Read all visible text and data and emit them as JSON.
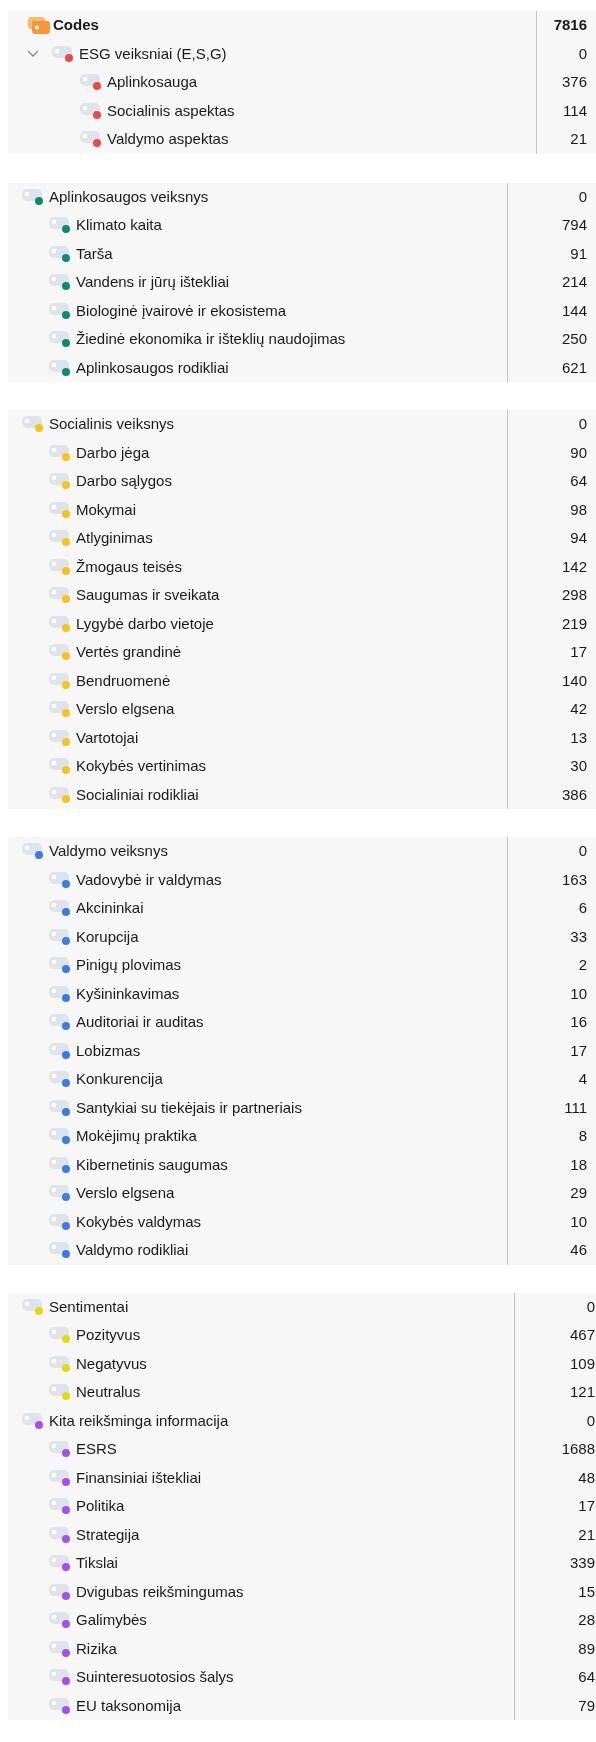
{
  "panels": [
    {
      "root": {
        "label": "Codes",
        "count": "7816"
      },
      "items": [
        {
          "label": "ESG veiksniai (E,S,G)",
          "count": "0",
          "color": "#ec4a4a",
          "expanded": true,
          "children": [
            {
              "label": "Aplinkosauga",
              "count": "376",
              "color": "#ec4a4a"
            },
            {
              "label": "Socialinis aspektas",
              "count": "114",
              "color": "#ec4a4a"
            },
            {
              "label": "Valdymo aspektas",
              "count": "21",
              "color": "#ec4a4a"
            }
          ]
        }
      ]
    },
    {
      "items": [
        {
          "label": "Aplinkosaugos veiksnys",
          "count": "0",
          "color": "#0e8a6c",
          "children": [
            {
              "label": "Klimato kaita",
              "count": "794",
              "color": "#0e8a6c"
            },
            {
              "label": "Tarša",
              "count": "91",
              "color": "#0e8a6c"
            },
            {
              "label": "Vandens ir jūrų ištekliai",
              "count": "214",
              "color": "#0e8a6c"
            },
            {
              "label": "Biologinė įvairovė ir ekosistema",
              "count": "144",
              "color": "#0e8a6c"
            },
            {
              "label": "Žiedinė ekonomika ir išteklių naudojimas",
              "count": "250",
              "color": "#0e8a6c"
            },
            {
              "label": "Aplinkosaugos rodikliai",
              "count": "621",
              "color": "#0e8a6c"
            }
          ]
        }
      ]
    },
    {
      "items": [
        {
          "label": "Socialinis veiksnys",
          "count": "0",
          "color": "#f7c31c",
          "children": [
            {
              "label": "Darbo jėga",
              "count": "90",
              "color": "#f7c31c"
            },
            {
              "label": "Darbo sąlygos",
              "count": "64",
              "color": "#f7c31c"
            },
            {
              "label": "Mokymai",
              "count": "98",
              "color": "#f7c31c"
            },
            {
              "label": "Atlyginimas",
              "count": "94",
              "color": "#f7c31c"
            },
            {
              "label": "Žmogaus teisės",
              "count": "142",
              "color": "#f7c31c"
            },
            {
              "label": "Saugumas ir sveikata",
              "count": "298",
              "color": "#f7c31c"
            },
            {
              "label": "Lygybė darbo vietoje",
              "count": "219",
              "color": "#f7c31c"
            },
            {
              "label": "Vertės grandinė",
              "count": "17",
              "color": "#f7c31c"
            },
            {
              "label": "Bendruomenė",
              "count": "140",
              "color": "#f7c31c"
            },
            {
              "label": "Verslo elgsena",
              "count": "42",
              "color": "#f7c31c"
            },
            {
              "label": "Vartotojai",
              "count": "13",
              "color": "#f7c31c"
            },
            {
              "label": "Kokybės vertinimas",
              "count": "30",
              "color": "#f7c31c"
            },
            {
              "label": "Socialiniai rodikliai",
              "count": "386",
              "color": "#f7c31c"
            }
          ]
        }
      ]
    },
    {
      "items": [
        {
          "label": "Valdymo veiksnys",
          "count": "0",
          "color": "#3b7be8",
          "children": [
            {
              "label": "Vadovybė ir valdymas",
              "count": "163",
              "color": "#3b7be8"
            },
            {
              "label": "Akcininkai",
              "count": "6",
              "color": "#3b7be8"
            },
            {
              "label": "Korupcija",
              "count": "33",
              "color": "#3b7be8"
            },
            {
              "label": "Pinigų plovimas",
              "count": "2",
              "color": "#3b7be8"
            },
            {
              "label": "Kyšininkavimas",
              "count": "10",
              "color": "#3b7be8"
            },
            {
              "label": "Auditoriai ir auditas",
              "count": "16",
              "color": "#3b7be8"
            },
            {
              "label": "Lobizmas",
              "count": "17",
              "color": "#3b7be8"
            },
            {
              "label": "Konkurencija",
              "count": "4",
              "color": "#3b7be8"
            },
            {
              "label": "Santykiai su tiekėjais ir partneriais",
              "count": "111",
              "color": "#3b7be8"
            },
            {
              "label": "Mokėjimų praktika",
              "count": "8",
              "color": "#3b7be8"
            },
            {
              "label": "Kibernetinis saugumas",
              "count": "18",
              "color": "#3b7be8"
            },
            {
              "label": "Verslo elgsena",
              "count": "29",
              "color": "#3b7be8"
            },
            {
              "label": "Kokybės valdymas",
              "count": "10",
              "color": "#3b7be8"
            },
            {
              "label": "Valdymo rodikliai",
              "count": "46",
              "color": "#3b7be8"
            }
          ]
        }
      ]
    },
    {
      "items": [
        {
          "label": "Sentimentai",
          "count": "0",
          "color": "#e4da10",
          "children": [
            {
              "label": "Pozityvus",
              "count": "467",
              "color": "#e4da10"
            },
            {
              "label": "Negatyvus",
              "count": "109",
              "color": "#e4da10"
            },
            {
              "label": "Neutralus",
              "count": "121",
              "color": "#e4da10"
            }
          ]
        },
        {
          "label": "Kita reikšminga informacija",
          "count": "0",
          "color": "#a64ff0",
          "children": [
            {
              "label": "ESRS",
              "count": "1688",
              "color": "#a64ff0"
            },
            {
              "label": "Finansiniai ištekliai",
              "count": "48",
              "color": "#a64ff0"
            },
            {
              "label": "Politika",
              "count": "17",
              "color": "#a64ff0"
            },
            {
              "label": "Strategija",
              "count": "21",
              "color": "#a64ff0"
            },
            {
              "label": "Tikslai",
              "count": "339",
              "color": "#a64ff0"
            },
            {
              "label": "Dvigubas reikšmingumas",
              "count": "15",
              "color": "#a64ff0"
            },
            {
              "label": "Galimybės",
              "count": "28",
              "color": "#a64ff0"
            },
            {
              "label": "Rizika",
              "count": "89",
              "color": "#a64ff0"
            },
            {
              "label": "Suinteresuotosios šalys",
              "count": "64",
              "color": "#a64ff0"
            },
            {
              "label": "EU taksonomija",
              "count": "79",
              "color": "#a64ff0"
            }
          ]
        }
      ]
    }
  ]
}
